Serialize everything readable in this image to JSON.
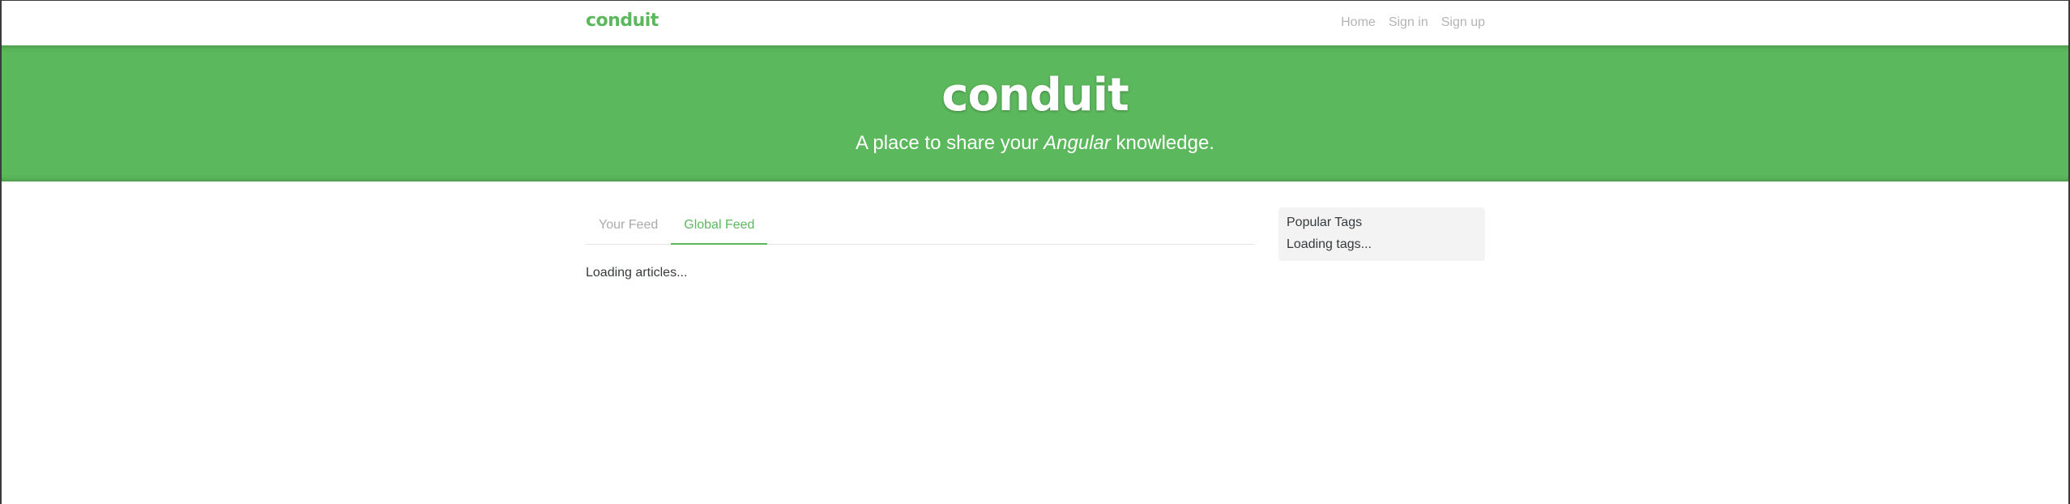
{
  "navbar": {
    "brand": "conduit",
    "links": [
      {
        "label": "Home"
      },
      {
        "label": "Sign in"
      },
      {
        "label": "Sign up"
      }
    ]
  },
  "banner": {
    "title": "conduit",
    "subtitle_prefix": "A place to share your ",
    "subtitle_emphasis": "Angular",
    "subtitle_suffix": " knowledge."
  },
  "feed": {
    "tabs": [
      {
        "label": "Your Feed",
        "active": false
      },
      {
        "label": "Global Feed",
        "active": true
      }
    ],
    "status": "Loading articles..."
  },
  "sidebar": {
    "heading": "Popular Tags",
    "status": "Loading tags..."
  },
  "colors": {
    "accent": "#5cb85c",
    "muted_link": "#b3b3b3",
    "sidebar_bg": "#f3f3f3"
  }
}
